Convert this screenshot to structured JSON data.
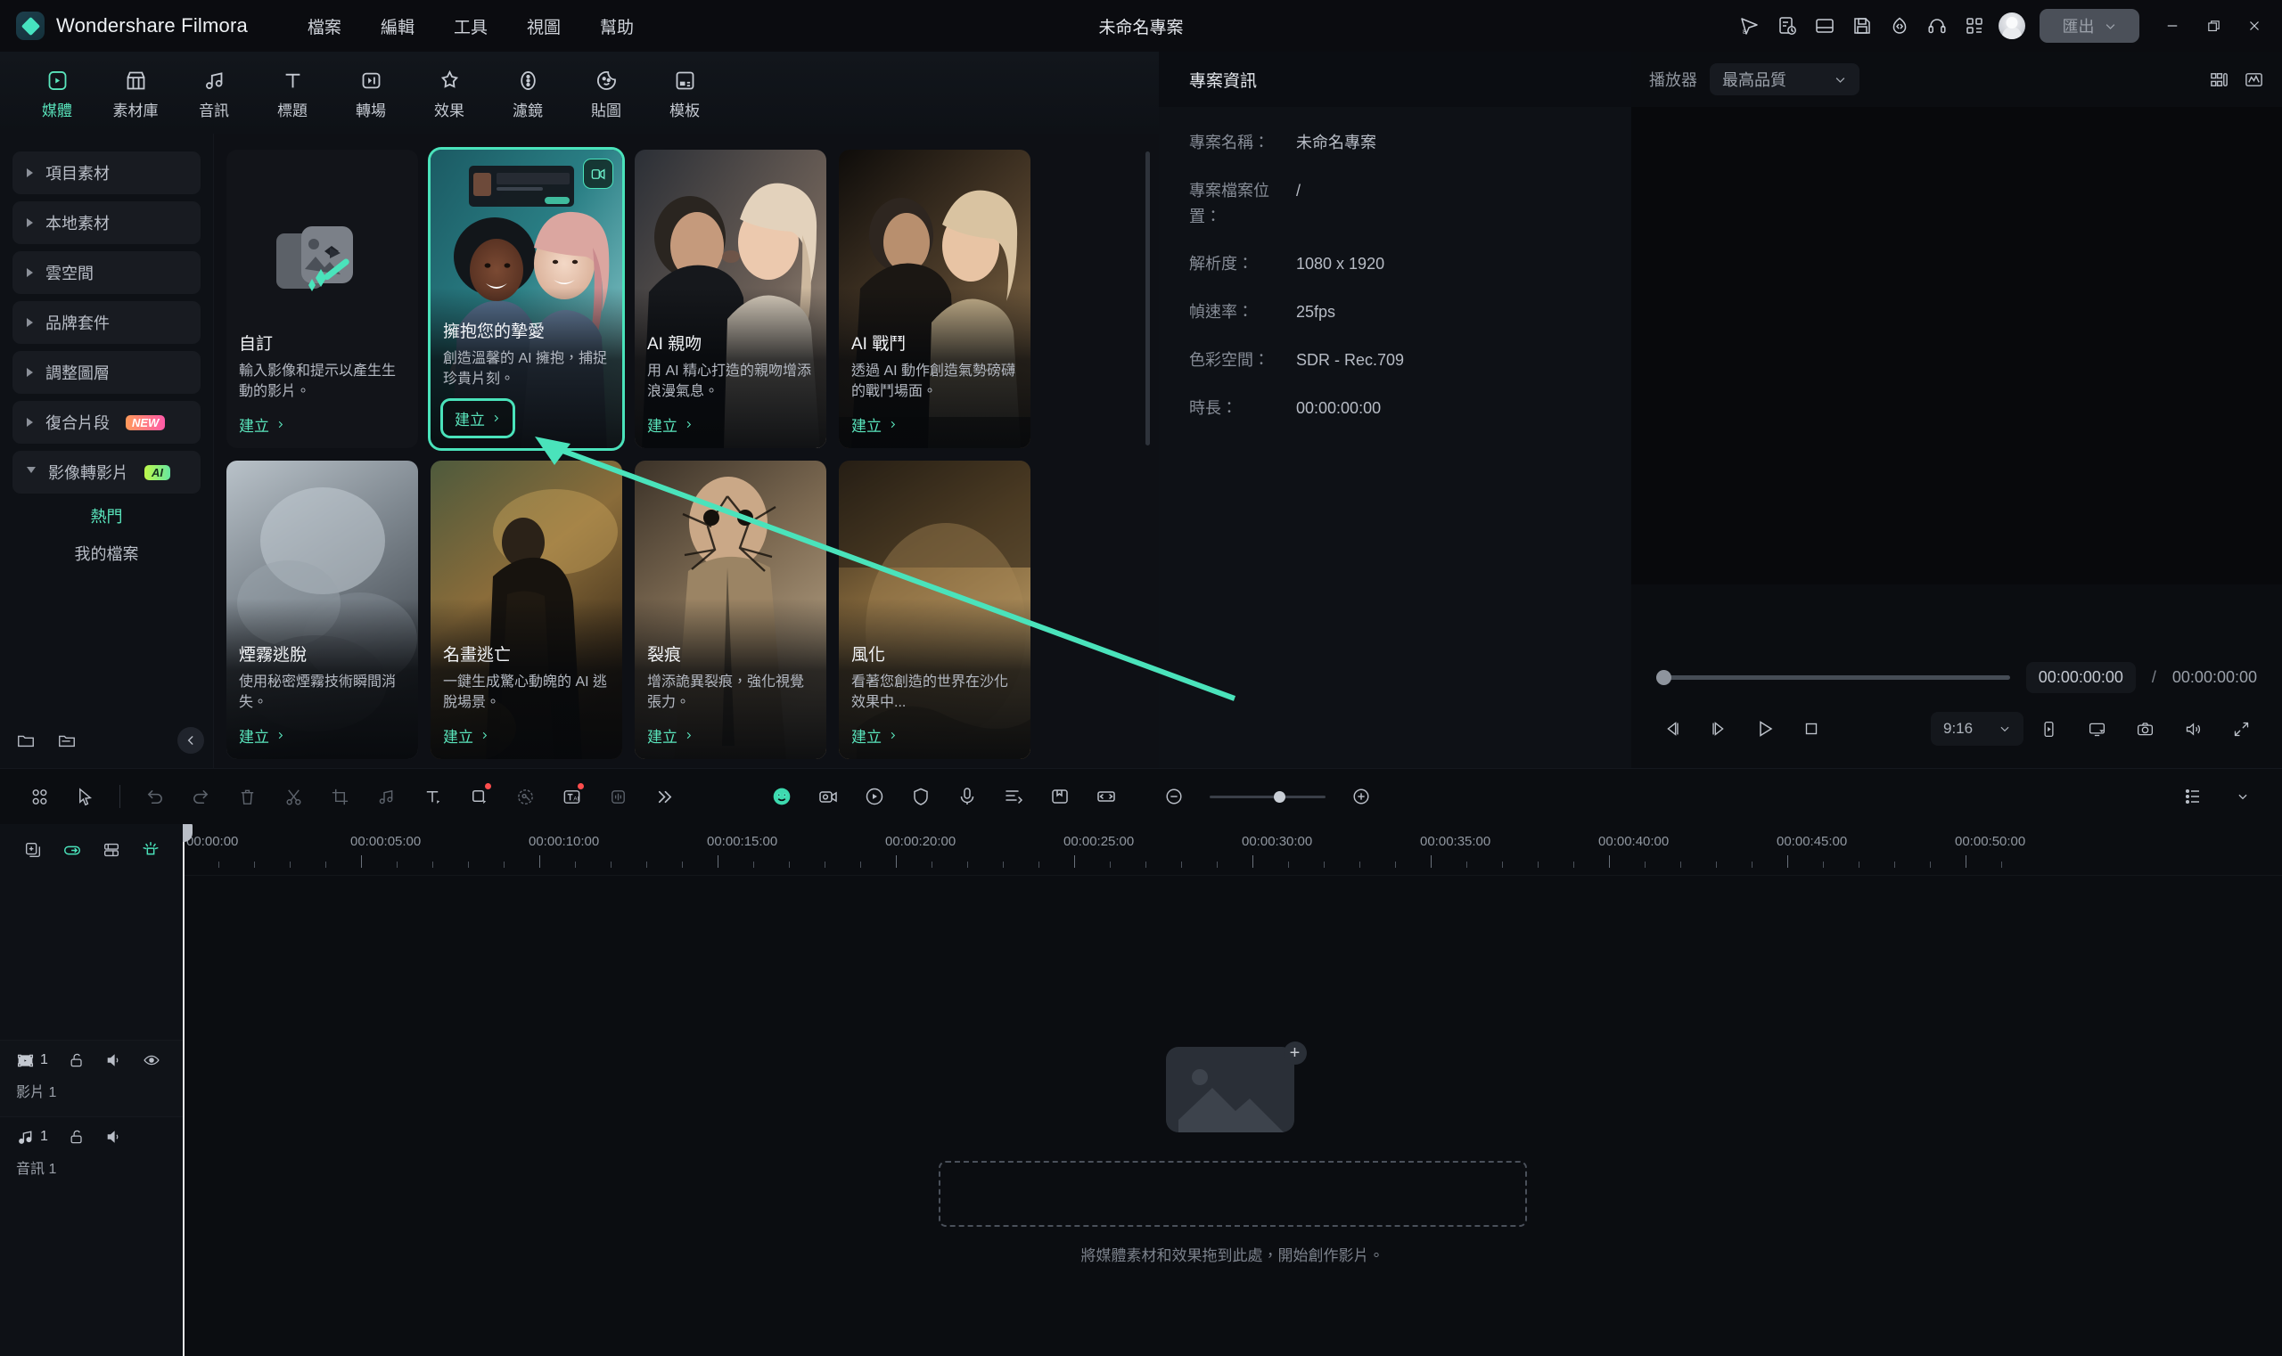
{
  "titlebar": {
    "brand": "Wondershare Filmora",
    "menus": [
      "檔案",
      "編輯",
      "工具",
      "視圖",
      "幫助"
    ],
    "project_title": "未命名專案",
    "export_label": "匯出",
    "icons": [
      "send-icon",
      "notes-clock-icon",
      "layout-icon",
      "save-icon",
      "cloud-code-icon",
      "headset-support-icon",
      "grid-apps-icon"
    ]
  },
  "resource_tabs": [
    {
      "label": "媒體",
      "icon": "media-icon",
      "active": true
    },
    {
      "label": "素材庫",
      "icon": "stock-library-icon",
      "active": false
    },
    {
      "label": "音訊",
      "icon": "audio-note-icon",
      "active": false
    },
    {
      "label": "標題",
      "icon": "title-text-icon",
      "active": false
    },
    {
      "label": "轉場",
      "icon": "transition-icon",
      "active": false
    },
    {
      "label": "效果",
      "icon": "effects-sparkle-icon",
      "active": false
    },
    {
      "label": "濾鏡",
      "icon": "filter-icon",
      "active": false
    },
    {
      "label": "貼圖",
      "icon": "sticker-icon",
      "active": false
    },
    {
      "label": "模板",
      "icon": "template-icon",
      "active": false
    }
  ],
  "sidebar": {
    "items": [
      {
        "label": "項目素材",
        "expanded": false,
        "badge": null
      },
      {
        "label": "本地素材",
        "expanded": false,
        "badge": null
      },
      {
        "label": "雲空間",
        "expanded": false,
        "badge": null
      },
      {
        "label": "品牌套件",
        "expanded": false,
        "badge": null
      },
      {
        "label": "調整圖層",
        "expanded": false,
        "badge": null
      },
      {
        "label": "復合片段",
        "expanded": false,
        "badge": "NEW"
      },
      {
        "label": "影像轉影片",
        "expanded": true,
        "badge": "AI"
      }
    ],
    "sub_items": [
      {
        "label": "熱門",
        "selected": true
      },
      {
        "label": "我的檔案",
        "selected": false
      }
    ],
    "footer_icons": [
      "new-folder-icon",
      "open-folder-icon",
      "collapse-left-icon"
    ]
  },
  "cards": [
    {
      "title": "自訂",
      "desc": "輸入影像和提示以產生生動的影片。",
      "cta": "建立",
      "kind": "custom",
      "selected": false,
      "cta_highlight": false
    },
    {
      "title": "擁抱您的摯愛",
      "desc": "創造溫馨的 AI 擁抱，捕捉珍貴片刻。",
      "cta": "建立",
      "kind": "photo-hug",
      "selected": true,
      "cta_highlight": true
    },
    {
      "title": "AI 親吻",
      "desc": "用 AI 精心打造的親吻增添浪漫氣息。",
      "cta": "建立",
      "kind": "photo-kiss",
      "selected": false,
      "cta_highlight": false
    },
    {
      "title": "AI 戰鬥",
      "desc": "透過 AI 動作創造氣勢磅礴的戰鬥場面。",
      "cta": "建立",
      "kind": "photo-fight",
      "selected": false,
      "cta_highlight": false
    },
    {
      "title": "煙霧逃脫",
      "desc": "使用秘密煙霧技術瞬間消失。",
      "cta": "建立",
      "kind": "photo-smoke",
      "selected": false,
      "cta_highlight": false
    },
    {
      "title": "名畫逃亡",
      "desc": "一鍵生成驚心動魄的 AI 逃脫場景。",
      "cta": "建立",
      "kind": "photo-painting",
      "selected": false,
      "cta_highlight": false
    },
    {
      "title": "裂痕",
      "desc": "增添詭異裂痕，強化視覺張力。",
      "cta": "建立",
      "kind": "photo-crack",
      "selected": false,
      "cta_highlight": false
    },
    {
      "title": "風化",
      "desc": "看著您創造的世界在沙化效果中...",
      "cta": "建立",
      "kind": "photo-weather",
      "selected": false,
      "cta_highlight": false
    }
  ],
  "project_info": {
    "heading": "專案資訊",
    "rows": [
      {
        "label": "專案名稱：",
        "value": "未命名專案"
      },
      {
        "label": "專案檔案位置：",
        "value": "/"
      },
      {
        "label": "解析度：",
        "value": "1080 x 1920"
      },
      {
        "label": "幀速率：",
        "value": "25fps"
      },
      {
        "label": "色彩空間：",
        "value": "SDR - Rec.709"
      },
      {
        "label": "時長：",
        "value": "00:00:00:00"
      }
    ]
  },
  "player": {
    "label": "播放器",
    "quality": "最高品質",
    "header_icons": [
      "snapshot-grid-icon",
      "waveform-scope-icon"
    ],
    "current_time": "00:00:00:00",
    "total_time": "00:00:00:00",
    "time_separator": "/",
    "aspect_ratio": "9:16",
    "controls": [
      "prev-frame-icon",
      "next-frame-icon",
      "play-icon",
      "stop-icon"
    ],
    "right_icons": [
      "device-preview-icon",
      "cast-screen-icon",
      "snapshot-camera-icon",
      "volume-icon",
      "fullscreen-icon"
    ]
  },
  "timeline": {
    "toolbar_icons": [
      "apps-grid-icon",
      "select-cursor-icon",
      "undo-icon",
      "redo-icon",
      "delete-trash-icon",
      "split-scissors-icon",
      "crop-icon",
      "audio-detach-icon",
      "add-text-icon",
      "add-shape-icon",
      "keyframe-icon",
      "ai-text-icon",
      "audio-wave-icon",
      "more-chevrons-icon"
    ],
    "center_icons": [
      "green-screen-icon",
      "record-camera-icon",
      "screen-record-icon",
      "mask-shield-icon",
      "voiceover-mic-icon",
      "auto-caption-icon",
      "marker-icon",
      "fit-timeline-icon"
    ],
    "zoom_out_icon": "zoom-out-icon",
    "zoom_in_icon": "zoom-in-icon",
    "list-view-icon": "list-view-icon",
    "track_tools": [
      "duplicate-track-icon",
      "link-clips-icon",
      "track-manager-icon",
      "auto-highlight-icon"
    ],
    "ruler_labels": [
      "00:00:00",
      "00:00:05:00",
      "00:00:10:00",
      "00:00:15:00",
      "00:00:20:00",
      "00:00:25:00",
      "00:00:30:00",
      "00:00:35:00",
      "00:00:40:00",
      "00:00:45:00",
      "00:00:50:00"
    ],
    "tracks": [
      {
        "name": "影片 1",
        "index": "1",
        "type": "video",
        "icons": [
          "film-icon",
          "unlock-icon",
          "mute-icon",
          "eye-icon"
        ]
      },
      {
        "name": "音訊 1",
        "index": "1",
        "type": "audio",
        "icons": [
          "music-icon",
          "unlock-icon",
          "mute-icon"
        ]
      }
    ],
    "drop_hint": "將媒體素材和效果拖到此處，開始創作影片。"
  },
  "colors": {
    "accent": "#4ae3bb",
    "accent_text": "#5ae6bd",
    "bg": "#0b0d11",
    "panel": "#0e1116",
    "new_badge_start": "#ff9a5a",
    "new_badge_end": "#ff5aa8",
    "ai_badge_start": "#bdf84a",
    "ai_badge_end": "#66e6a0"
  }
}
